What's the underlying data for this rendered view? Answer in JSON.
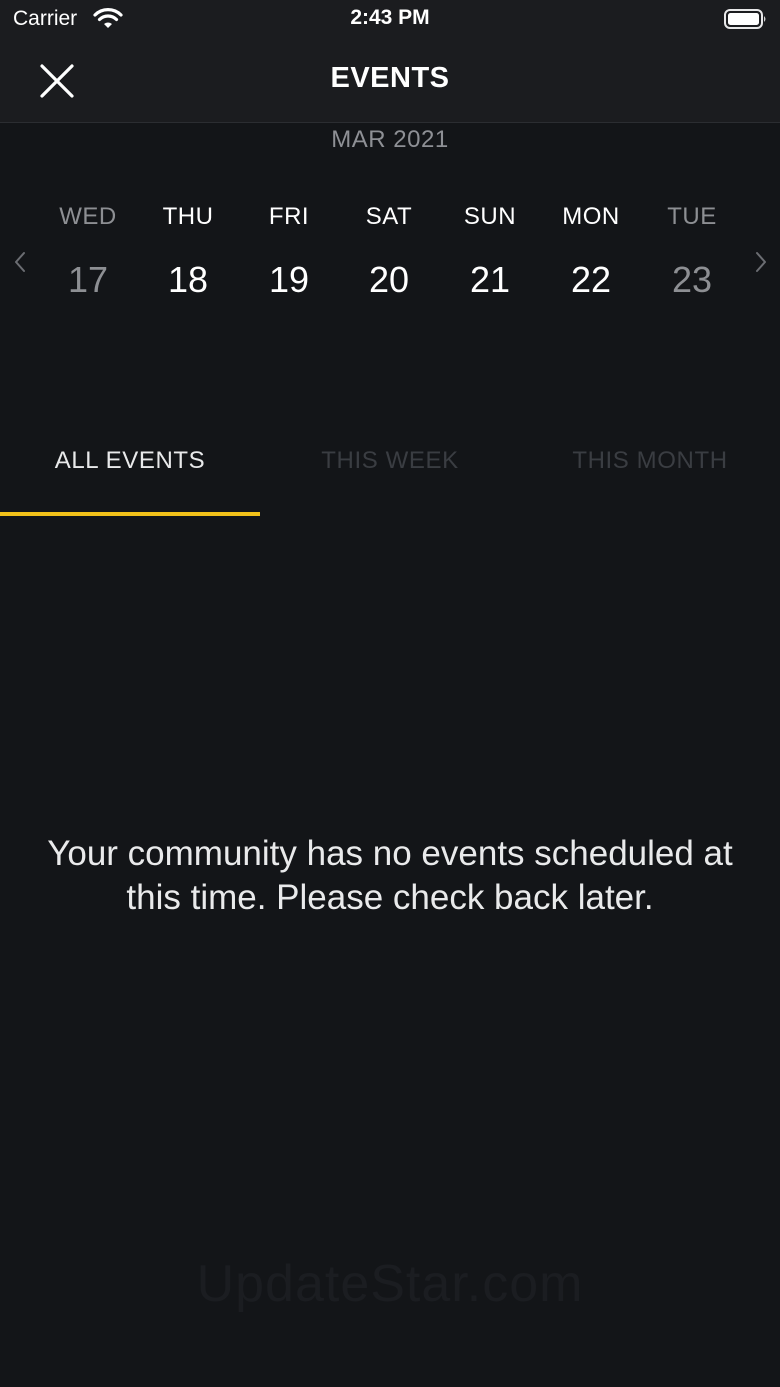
{
  "status_bar": {
    "carrier": "Carrier",
    "time": "2:43 PM"
  },
  "header": {
    "title": "EVENTS",
    "close_icon": "close-icon"
  },
  "calendar": {
    "month": "MAR 2021",
    "prev_icon": "chevron-left-icon",
    "next_icon": "chevron-right-icon",
    "days": [
      {
        "name": "WED",
        "number": "17",
        "muted": true
      },
      {
        "name": "THU",
        "number": "18",
        "muted": false
      },
      {
        "name": "FRI",
        "number": "19",
        "muted": false
      },
      {
        "name": "SAT",
        "number": "20",
        "muted": false
      },
      {
        "name": "SUN",
        "number": "21",
        "muted": false
      },
      {
        "name": "MON",
        "number": "22",
        "muted": false
      },
      {
        "name": "TUE",
        "number": "23",
        "muted": true
      }
    ]
  },
  "tabs": [
    {
      "label": "ALL EVENTS",
      "active": true
    },
    {
      "label": "THIS WEEK",
      "active": false
    },
    {
      "label": "THIS MONTH",
      "active": false
    }
  ],
  "empty_state": {
    "message": "Your community has no events scheduled at this time. Please check back later."
  },
  "watermark": "UpdateStar.com",
  "colors": {
    "background": "#131518",
    "header": "#1b1c1f",
    "accent": "#f2c21a",
    "muted_text": "#8d8f93"
  }
}
